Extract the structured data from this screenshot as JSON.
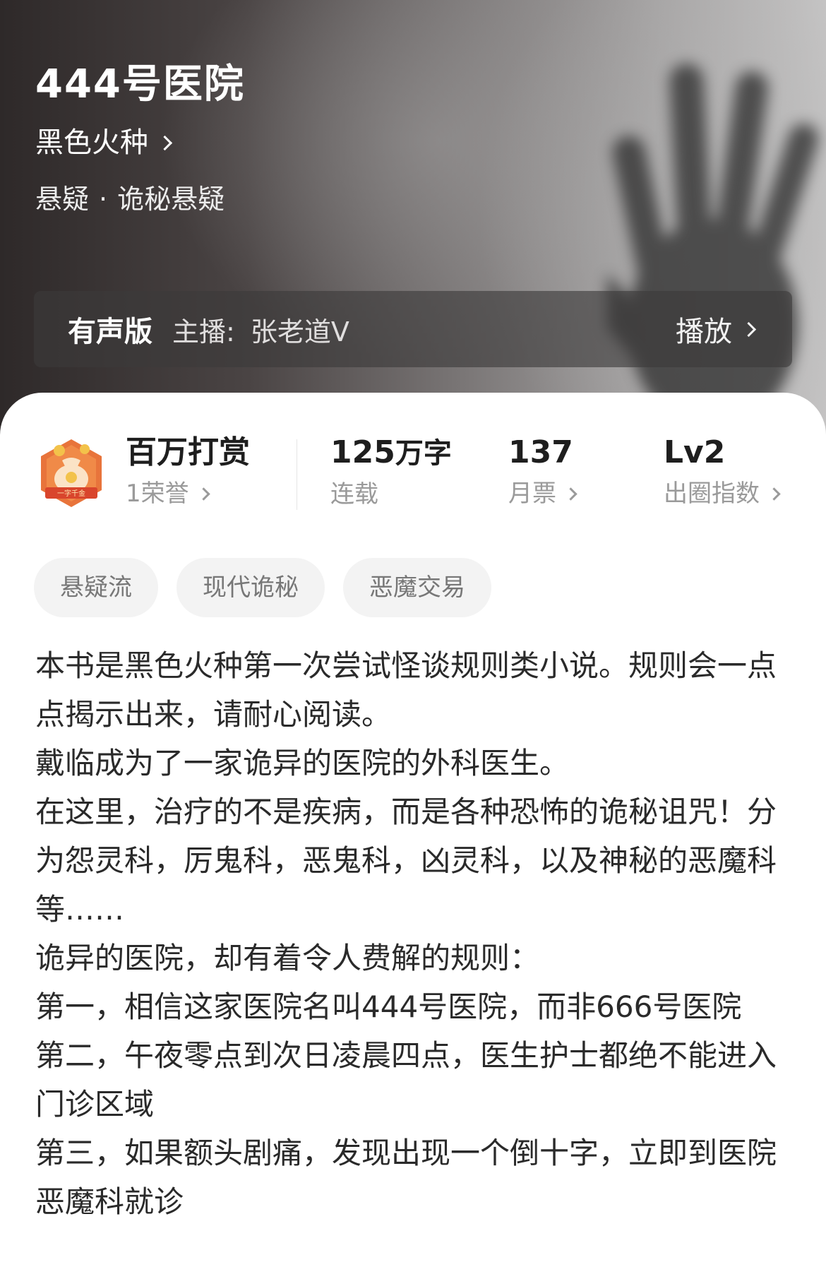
{
  "header": {
    "title": "444号医院",
    "author": "黑色火种",
    "genre_primary": "悬疑",
    "genre_separator": "·",
    "genre_secondary": "诡秘悬疑"
  },
  "audio": {
    "label": "有声版",
    "host_label": "主播:",
    "host": "张老道V",
    "play_label": "播放"
  },
  "stats": {
    "badge": {
      "title": "百万打赏",
      "subtitle": "1荣誉",
      "icon": "money-bag-badge-icon",
      "icon_text": "一字千金"
    },
    "words": {
      "value": "125",
      "unit": "万字",
      "label": "连载"
    },
    "monthly_tickets": {
      "value": "137",
      "label": "月票"
    },
    "popularity": {
      "value": "Lv2",
      "label": "出圈指数"
    }
  },
  "tags": [
    "悬疑流",
    "现代诡秘",
    "恶魔交易"
  ],
  "description": [
    "本书是黑色火种第一次尝试怪谈规则类小说。规则会一点点揭示出来，请耐心阅读。",
    "戴临成为了一家诡异的医院的外科医生。",
    "在这里，治疗的不是疾病，而是各种恐怖的诡秘诅咒！分为怨灵科，厉鬼科，恶鬼科，凶灵科，以及神秘的恶魔科等……",
    "诡异的医院，却有着令人费解的规则：",
    "第一，相信这家医院名叫444号医院，而非666号医院",
    "第二，午夜零点到次日凌晨四点，医生护士都绝不能进入门诊区域",
    "第三，如果额头剧痛，发现出现一个倒十字，立即到医院恶魔科就诊"
  ],
  "colors": {
    "badge_orange": "#e8743b",
    "badge_red": "#d9452c",
    "badge_gold": "#f3c24a"
  }
}
